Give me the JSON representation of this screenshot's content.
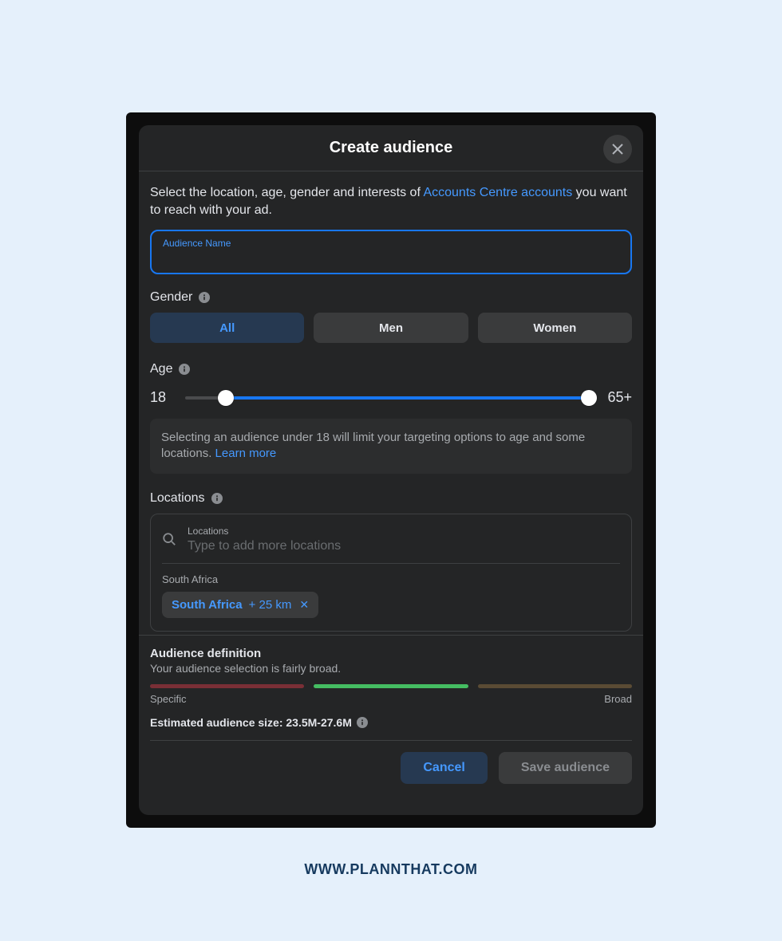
{
  "modal": {
    "title": "Create audience",
    "description_pre": "Select the location, age, gender and interests of ",
    "description_link": "Accounts Centre accounts",
    "description_post": " you want to reach with your ad.",
    "audience_name_label": "Audience Name",
    "audience_name_value": ""
  },
  "gender": {
    "label": "Gender",
    "options": [
      "All",
      "Men",
      "Women"
    ],
    "selected": "All"
  },
  "age": {
    "label": "Age",
    "min": "18",
    "max": "65+",
    "note_pre": "Selecting an audience under 18 will limit your targeting options to age and some locations. ",
    "note_link": "Learn more"
  },
  "locations": {
    "label": "Locations",
    "field_label": "Locations",
    "placeholder": "Type to add more locations",
    "country_label": "South Africa",
    "chip_name": "South Africa",
    "chip_extra": "+ 25 km"
  },
  "definition": {
    "heading": "Audience definition",
    "sub": "Your audience selection is fairly broad.",
    "specific": "Specific",
    "broad": "Broad",
    "estimate": "Estimated audience size: 23.5M-27.6M"
  },
  "buttons": {
    "cancel": "Cancel",
    "save": "Save audience"
  },
  "watermark": "WWW.PLANNTHAT.COM"
}
